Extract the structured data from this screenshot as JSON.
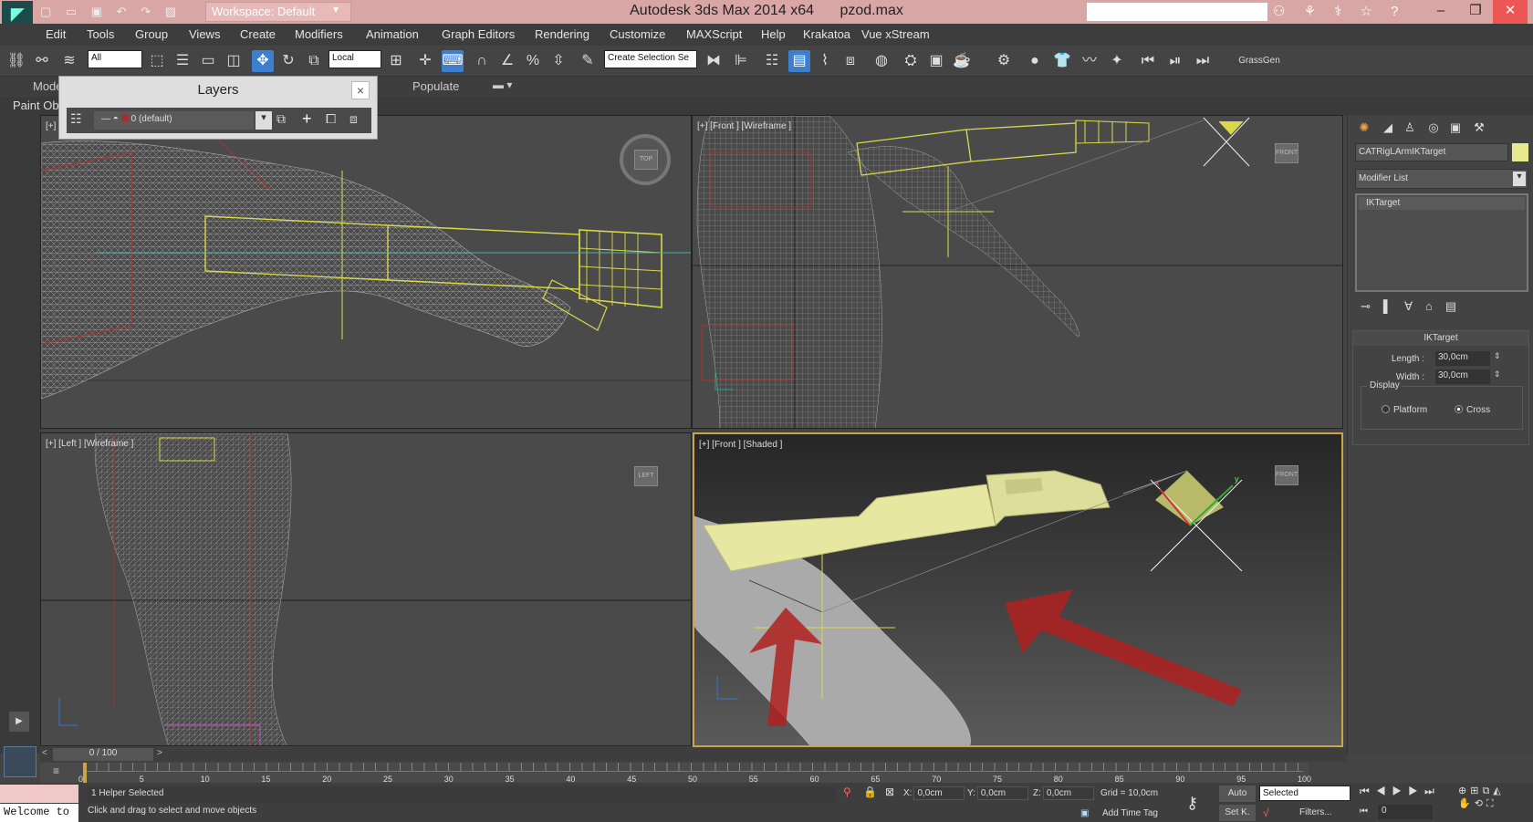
{
  "titlebar": {
    "workspace": "Workspace: Default",
    "app": "Autodesk 3ds Max  2014 x64",
    "file": "pzod.max"
  },
  "menu": [
    "Edit",
    "Tools",
    "Group",
    "Views",
    "Create",
    "Modifiers",
    "Animation",
    "Graph Editors",
    "Rendering",
    "Customize",
    "MAXScript",
    "Help",
    "Krakatoa",
    "Vue xStream"
  ],
  "toolbar": {
    "selection_filter": "All",
    "ref_coord": "Local",
    "named_selection": "Create Selection Se",
    "plugin_label": "GrassGen"
  },
  "ribbon": {
    "tab_modeling": "Mode",
    "tab_populate": "Populate",
    "sub_paint": "Paint Ob"
  },
  "layers": {
    "title": "Layers",
    "current": "0 (default)"
  },
  "viewports": {
    "top_left_label": "[+]",
    "top_right_label": "[+] [Front ] [Wireframe ]",
    "bottom_left_label": "[+] [Left ] [Wireframe ]",
    "bottom_right_label": "[+] [Front ] [Shaded ]",
    "cube_top": "TOP",
    "cube_front": "FRONT",
    "cube_left": "LEFT"
  },
  "command_panel": {
    "object_name": "CATRigLArmIKTarget",
    "object_color": "#e8e890",
    "modifier_list": "Modifier List",
    "stack_entry": "IKTarget",
    "rollout_title": "IKTarget",
    "length_label": "Length :",
    "length_value": "30,0cm",
    "width_label": "Width :",
    "width_value": "30,0cm",
    "display_label": "Display",
    "platform_label": "Platform",
    "cross_label": "Cross",
    "display_selected": "Cross"
  },
  "timeline": {
    "slider": "0 / 100",
    "ticks": [
      "0",
      "5",
      "10",
      "15",
      "20",
      "25",
      "30",
      "35",
      "40",
      "45",
      "50",
      "55",
      "60",
      "65",
      "70",
      "75",
      "80",
      "85",
      "90",
      "95",
      "100"
    ]
  },
  "status": {
    "maxscript": "Welcome to",
    "selection": "1 Helper Selected",
    "prompt": "Click and drag to select and move objects",
    "x_label": "X:",
    "x_value": "0,0cm",
    "y_label": "Y:",
    "y_value": "0,0cm",
    "z_label": "Z:",
    "z_value": "0,0cm",
    "grid": "Grid = 10,0cm",
    "add_time_tag": "Add Time Tag",
    "auto": "Auto",
    "set_key": "Set K.",
    "key_filter": "Selected",
    "filters": "Filters...",
    "frame": "0"
  },
  "colors": {
    "titlebar": "#d9a6a6",
    "accent": "#3c7fcf",
    "active_viewport_border": "#c9a44a",
    "annotation_arrow": "#b02020"
  }
}
